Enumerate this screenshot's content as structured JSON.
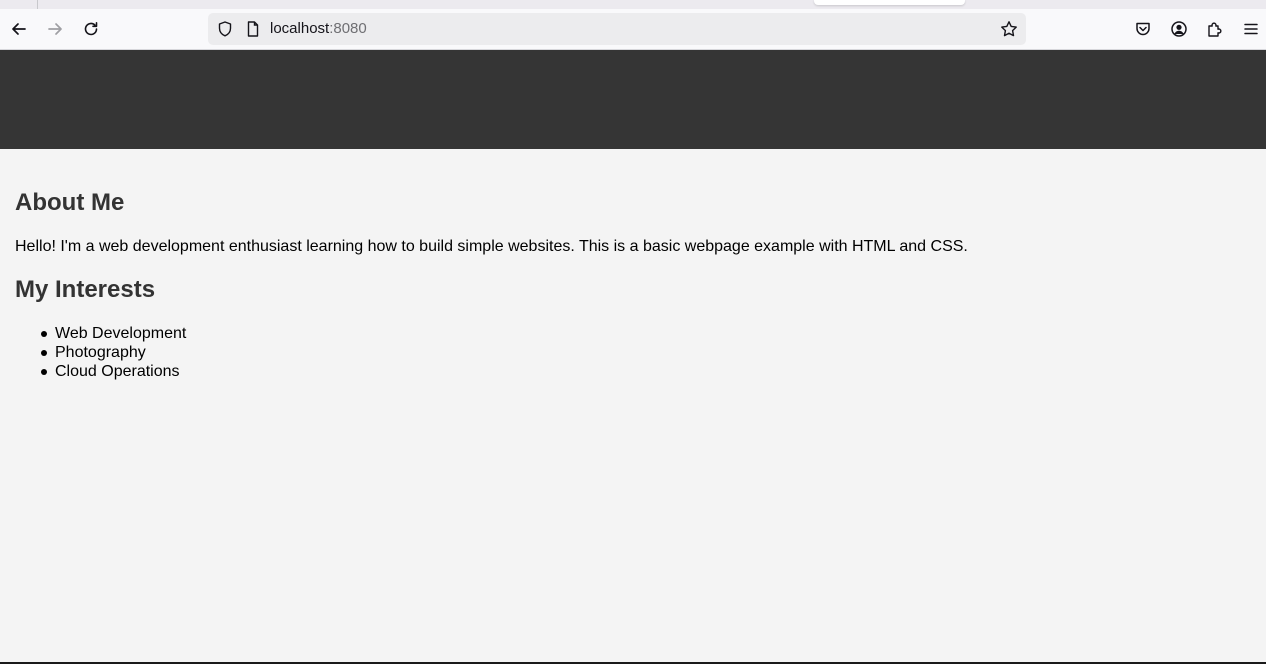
{
  "browser": {
    "url_host": "localhost",
    "url_port": ":8080",
    "icons": [
      "back-arrow-icon",
      "forward-arrow-icon",
      "reload-icon",
      "shield-icon",
      "page-icon",
      "star-icon",
      "pocket-icon",
      "account-icon",
      "extensions-icon",
      "menu-icon"
    ]
  },
  "page": {
    "about": {
      "title": "About Me",
      "text": "Hello! I'm a web development enthusiast learning how to build simple websites. This is a basic webpage example with HTML and CSS."
    },
    "interests": {
      "title": "My Interests",
      "items": [
        "Web Development",
        "Photography",
        "Cloud Operations"
      ]
    }
  },
  "colors": {
    "header_bg": "#353535",
    "page_bg": "#f4f4f4",
    "heading": "#333333"
  }
}
